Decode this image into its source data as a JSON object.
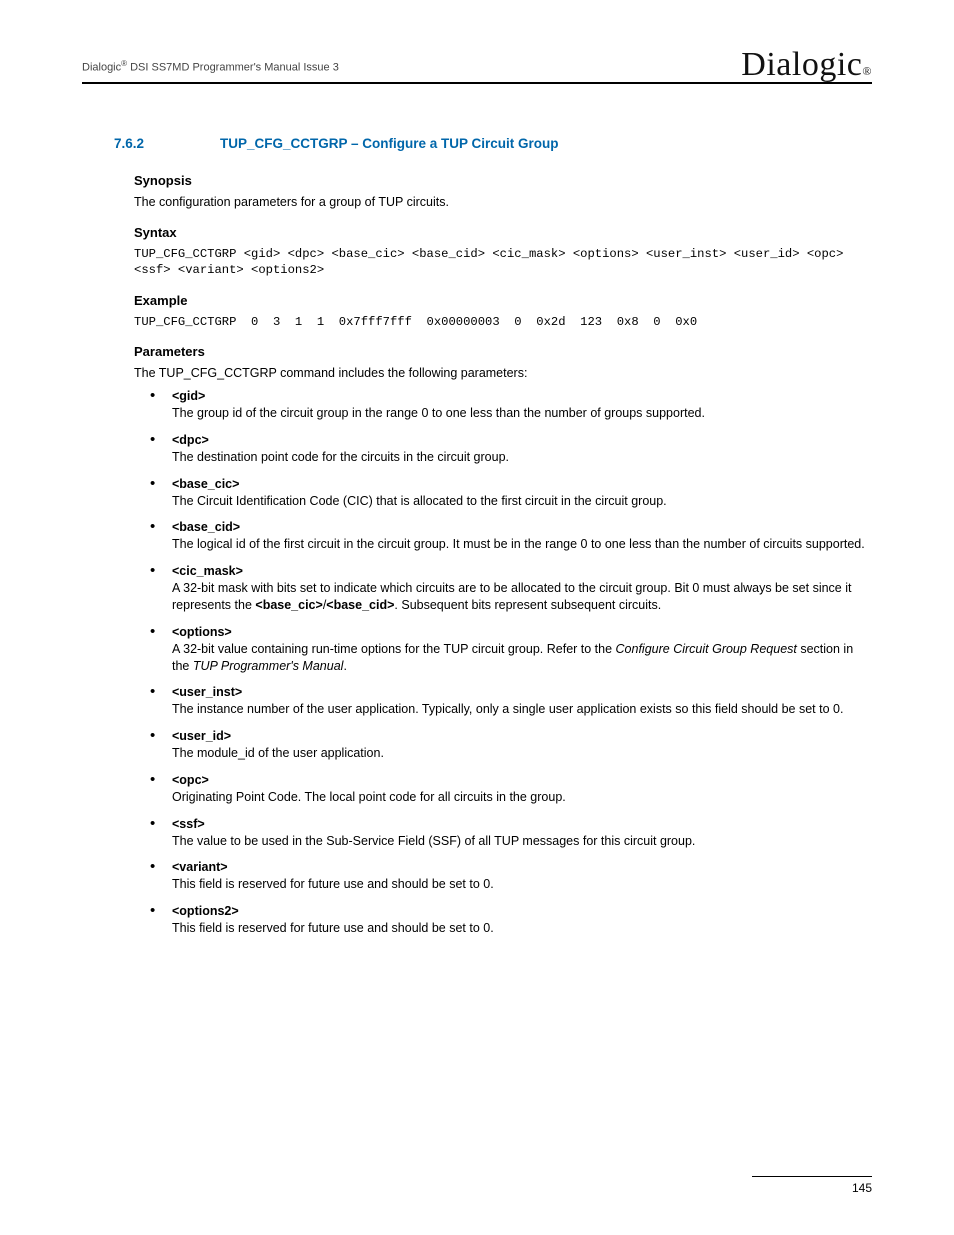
{
  "header": {
    "brand": "Dialogic",
    "manual": " DSI SS7MD Programmer's Manual  Issue 3",
    "logo": "Dialogic",
    "logo_reg": "®"
  },
  "section": {
    "number": "7.6.2",
    "title": "TUP_CFG_CCTGRP – Configure a TUP Circuit Group"
  },
  "synopsis": {
    "heading": "Synopsis",
    "text": "The configuration parameters for a group of TUP circuits."
  },
  "syntax": {
    "heading": "Syntax",
    "text": "TUP_CFG_CCTGRP <gid> <dpc> <base_cic> <base_cid> <cic_mask> <options> <user_inst> <user_id> <opc> <ssf> <variant> <options2>"
  },
  "example": {
    "heading": "Example",
    "text": "TUP_CFG_CCTGRP  0  3  1  1  0x7fff7fff  0x00000003  0  0x2d  123  0x8  0  0x0"
  },
  "parameters": {
    "heading": "Parameters",
    "intro": "The TUP_CFG_CCTGRP command includes the following parameters:",
    "items": [
      {
        "name": "<gid>",
        "desc": "The group id of the circuit group in the range 0 to one less than the number of groups supported."
      },
      {
        "name": "<dpc>",
        "desc": "The destination point code for the circuits in the circuit group."
      },
      {
        "name": "<base_cic>",
        "desc": "The Circuit Identification Code (CIC) that is allocated to the first circuit in the circuit group."
      },
      {
        "name": "<base_cid>",
        "desc": "The logical id of the first circuit in the circuit group. It must be in the range 0 to one less than the number of circuits supported."
      },
      {
        "name": "<cic_mask>",
        "desc_pre": "A 32-bit mask with bits set to indicate which circuits are to be allocated to the circuit group. Bit 0 must always be set since it represents the ",
        "bold1": "<base_cic>",
        "sep": "/",
        "bold2": "<base_cid>",
        "desc_post": ". Subsequent bits represent subsequent circuits."
      },
      {
        "name": "<options>",
        "desc_pre": "A 32-bit value containing run-time options for the TUP circuit group. Refer to the ",
        "ital1": "Configure Circuit Group Request",
        "mid": " section in the ",
        "ital2": "TUP Programmer's Manual",
        "desc_post": "."
      },
      {
        "name": "<user_inst>",
        "desc": "The instance number of the user application. Typically, only a single user application exists so this field should be set to 0."
      },
      {
        "name": "<user_id>",
        "desc": "The module_id of the user application."
      },
      {
        "name": "<opc>",
        "desc": "Originating Point Code. The local point code for all circuits in the group."
      },
      {
        "name": "<ssf>",
        "desc": "The value to be used in the Sub-Service Field (SSF) of all TUP messages for this circuit group."
      },
      {
        "name": "<variant>",
        "desc": "This field is reserved for future use and should be set to 0."
      },
      {
        "name": "<options2>",
        "desc": "This field is reserved for future use and should be set to 0."
      }
    ]
  },
  "footer": {
    "page": "145"
  }
}
